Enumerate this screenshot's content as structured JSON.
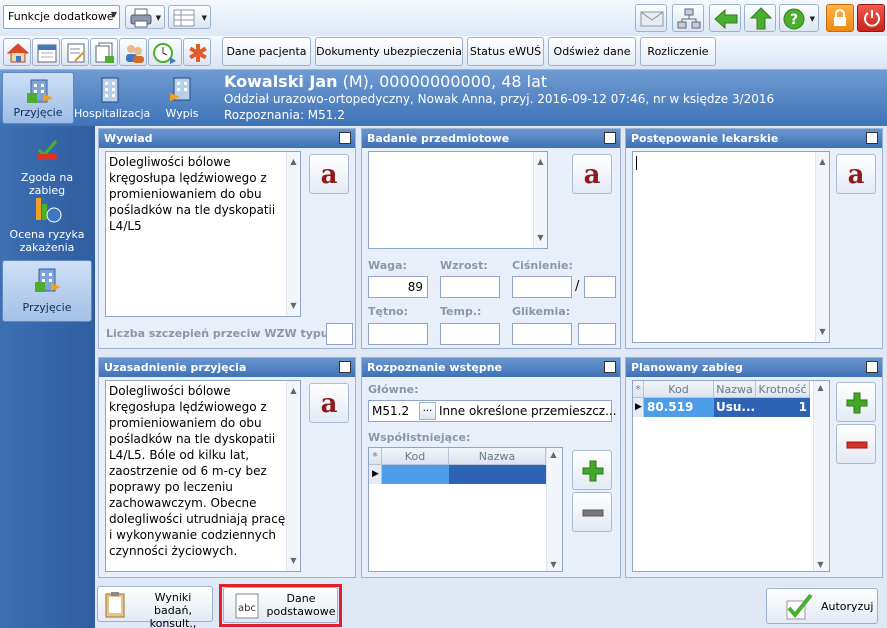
{
  "toolbar": {
    "functions_combo": "Funkcje dodatkowe",
    "buttons": [
      "Dane pacjenta",
      "Dokumenty ubezpieczenia",
      "Status eWUŚ",
      "Odśwież dane",
      "Rozliczenie"
    ]
  },
  "nav": {
    "top": [
      "Przyjęcie",
      "Hospitalizacja",
      "Wypis"
    ],
    "left": [
      "Zgoda na zabieg",
      "Ocena ryzyka zakażenia",
      "Przyjęcie"
    ]
  },
  "patient": {
    "name": "Kowalski Jan",
    "details": " (M), 00000000000, 48 lat",
    "ward_line": "Oddział urazowo-ortopedyczny, Nowak Anna, przyj. 2016-09-12 07:46, nr w księdze 3/2016",
    "diagnosis_line": "Rozpoznania: M51.2"
  },
  "wywiad": {
    "title": "Wywiad",
    "text_lines": [
      "Dolegliwości bólowe",
      "kręgosłupa lędźwiowego z",
      "promieniowaniem do obu",
      "pośladków na tle dyskopatii",
      "L4/L5"
    ],
    "vaccines_label": "Liczba szczepień przeciw WZW typu B:",
    "vaccines_value": ""
  },
  "badanie": {
    "title": "Badanie przedmiotowe",
    "labels": {
      "waga": "Waga:",
      "wzrost": "Wzrost:",
      "cisnienie": "Ciśnienie:",
      "tetno": "Tętno:",
      "temp": "Temp.:",
      "glikemia": "Glikemia:"
    },
    "values": {
      "waga": "89",
      "wzrost": "",
      "cisnienie_sys": "",
      "cisnienie_dia": "",
      "tetno": "",
      "temp": "",
      "glikemia": "",
      "glikemia_unit": ""
    },
    "separator": "/"
  },
  "postepowanie": {
    "title": "Postępowanie lekarskie",
    "text": ""
  },
  "uzasadnienie": {
    "title": "Uzasadnienie przyjęcia",
    "text_lines": [
      "Dolegliwości bólowe",
      "kręgosłupa lędźwiowego z",
      "promieniowaniem do obu",
      "pośladków na tle dyskopatii",
      "L4/L5. Bóle od kilku lat,",
      "zaostrzenie od 6 m-cy bez",
      "poprawy po leczeniu",
      "zachowawczym. Obecne",
      "dolegliwości utrudniają pracę",
      "i wykonywanie codziennych",
      "czynności życiowych."
    ]
  },
  "rozpoznanie": {
    "title": "Rozpoznanie wstępne",
    "main_label": "Główne:",
    "main_code": "M51.2",
    "main_ellipsis": "...",
    "main_name": "Inne określone przemieszcz...",
    "secondary_label": "Współistniejące:",
    "grid_headers": [
      "Kod",
      "Nazwa"
    ],
    "star": "*"
  },
  "zabieg": {
    "title": "Planowany zabieg",
    "grid_headers": [
      "Kod",
      "Nazwa",
      "Krotność"
    ],
    "star": "*",
    "rows": [
      {
        "kod": "80.519",
        "nazwa": "Usu...",
        "krotnosc": "1"
      }
    ]
  },
  "bottom": {
    "wyniki": "Wyniki badań, konsult., skier.",
    "dane_podstawowe_1": "Dane",
    "dane_podstawowe_2": "podstawowe",
    "autoryzuj": "Autoryzuj"
  },
  "colors": {
    "header_blue": "#3e72b6",
    "highlight_red": "#e0202a",
    "selected_row": "#2e62b5"
  }
}
